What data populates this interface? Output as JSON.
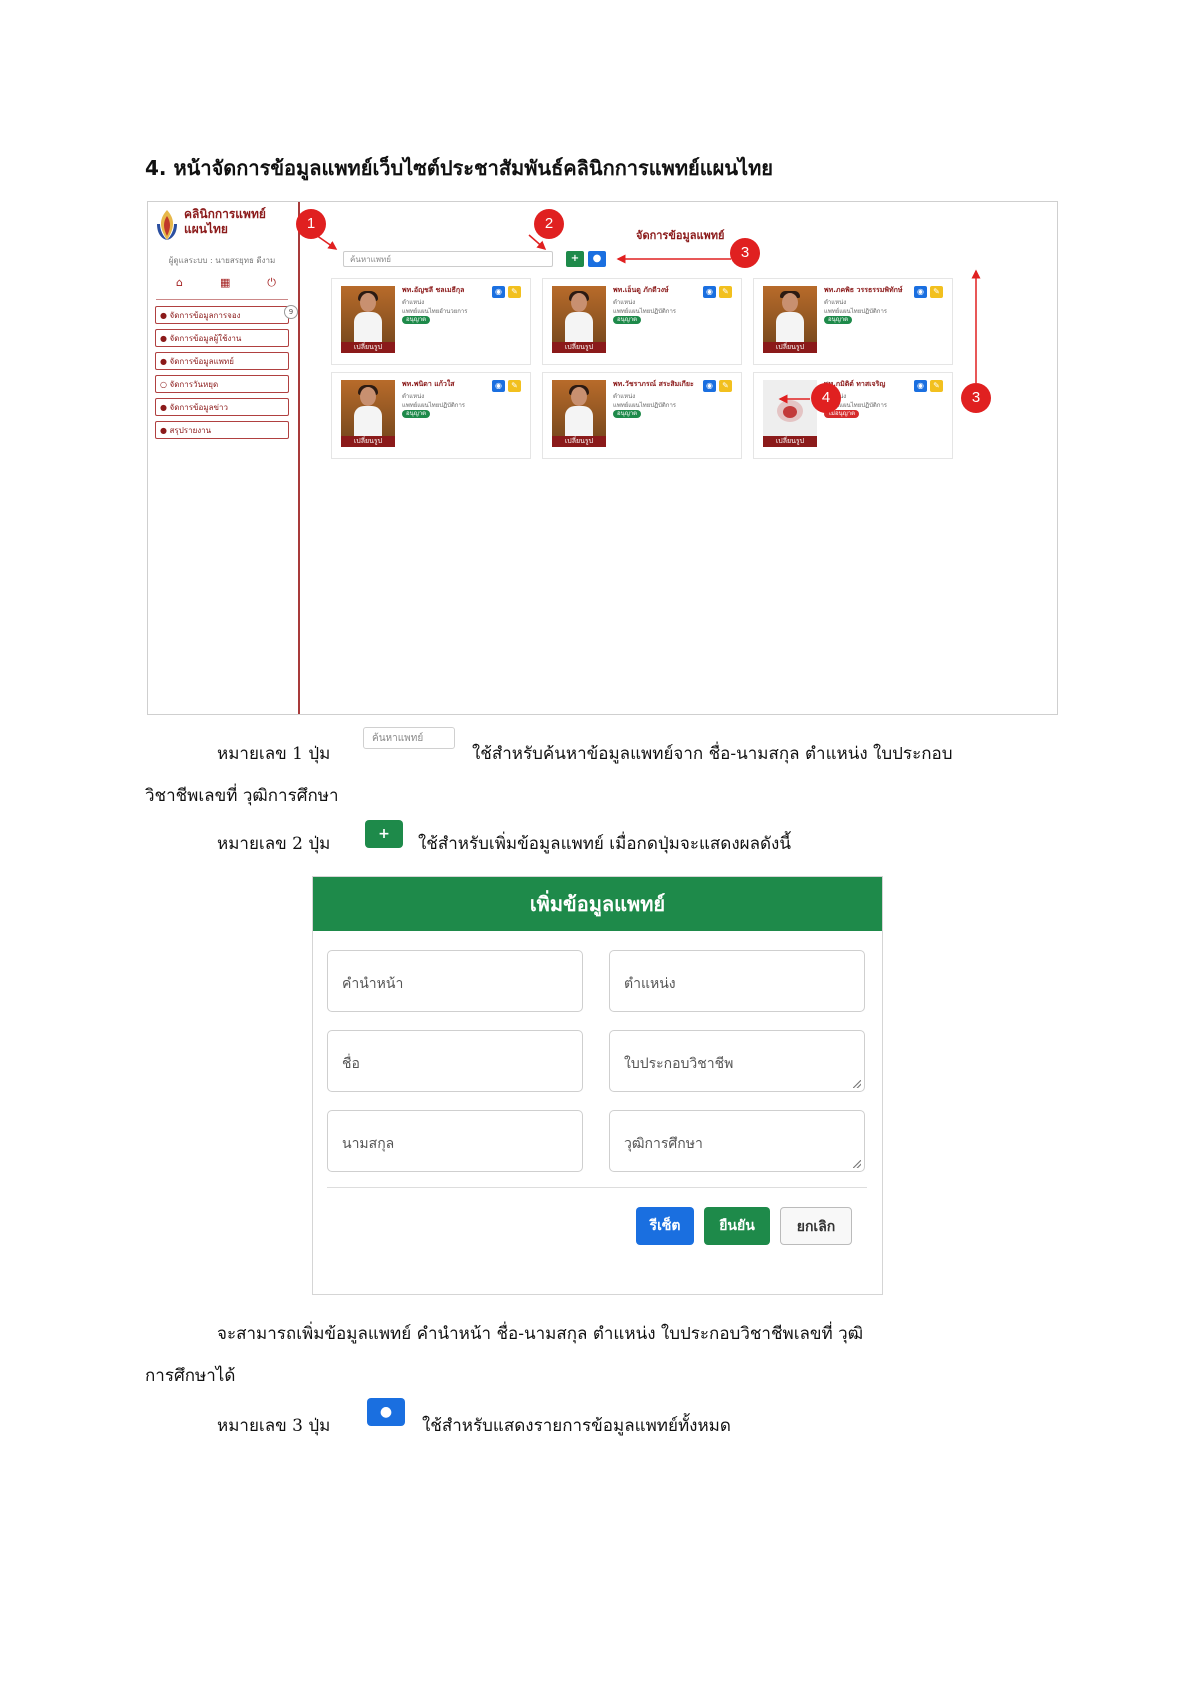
{
  "heading": "4. หน้าจัดการข้อมูลแพทย์เว็บไซต์ประชาสัมพันธ์คลินิกการแพทย์แผนไทย",
  "screenshot": {
    "brand": {
      "line1": "คลินิกการแพทย์",
      "line2": "แผนไทย"
    },
    "user": "ผู้ดูแลระบบ : นายสรยุทธ ดีงาม",
    "sidebar_icons": [
      "home-icon",
      "book-icon",
      "power-icon"
    ],
    "menu_badge": "9",
    "menu": [
      "จัดการข้อมูลการจอง",
      "จัดการข้อมูลผู้ใช้งาน",
      "จัดการข้อมูลแพทย์",
      "จัดการวันหยุด",
      "จัดการข้อมูลข่าว",
      "สรุปรายงาน"
    ],
    "main_title": "จัดการข้อมูลแพทย์",
    "search_placeholder": "ค้นหาแพทย์",
    "add_btn": "+",
    "position_label": "ตำแหน่ง",
    "change_image": "เปลี่ยนรูป",
    "doctors": [
      {
        "name": "พท.อัญชลี ชลเมธีกุล",
        "role": "แพทย์แผนไทยอำนวยการ",
        "status": "อนุญาต",
        "status_color": "#1e8a4a"
      },
      {
        "name": "พท.เอ็นดู ภักดีวงษ์",
        "role": "แพทย์แผนไทยปฏิบัติการ",
        "status": "อนุญาต",
        "status_color": "#1e8a4a"
      },
      {
        "name": "พท.ภคพิธ วรรธรรมพิทักษ์",
        "role": "แพทย์แผนไทยปฏิบัติการ",
        "status": "อนุญาต",
        "status_color": "#1e8a4a"
      },
      {
        "name": "พท.พนิดา แก้วใส",
        "role": "แพทย์แผนไทยปฏิบัติการ",
        "status": "อนุญาต",
        "status_color": "#1e8a4a"
      },
      {
        "name": "พท.วัชราภรณ์ สระสิมเกียะ",
        "role": "แพทย์แผนไทยปฏิบัติการ",
        "status": "อนุญาต",
        "status_color": "#1e8a4a"
      },
      {
        "name": "พท.กมิติต์ ทาสเจริญ",
        "role": "แพทย์แผนไทยปฏิบัติการ",
        "status": "ไม่อนุญาต",
        "status_color": "#d62b2b"
      }
    ],
    "callouts": [
      "1",
      "2",
      "3",
      "3",
      "4"
    ]
  },
  "para1": {
    "lead": "หมายเลข 1 ปุ่ม",
    "button": "ค้นหาแพทย์",
    "text": "ใช้สำหรับค้นหาข้อมูลแพทย์จาก ชื่อ-นามสกุล ตำแหน่ง ใบประกอบ",
    "cont": "วิชาชีพเลขที่ วุฒิการศึกษา"
  },
  "para2": {
    "lead": "หมายเลข 2 ปุ่ม",
    "button": "+",
    "text": "ใช้สำหรับเพิ่มข้อมูลแพทย์ เมื่อกดปุ่มจะแสดงผลดังนี้"
  },
  "modal": {
    "title": "เพิ่มข้อมูลแพทย์",
    "fields": {
      "prefix": "คำนำหน้า",
      "position": "ตำแหน่ง",
      "first_name": "ชื่อ",
      "license": "ใบประกอบวิชาชีพ",
      "last_name": "นามสกุล",
      "education": "วุฒิการศึกษา"
    },
    "reset": "รีเซ็ต",
    "confirm": "ยืนยัน",
    "cancel": "ยกเลิก"
  },
  "para3": {
    "text": "จะสามารถเพิ่มข้อมูลแพทย์ คำนำหน้า ชื่อ-นามสกุล  ตำแหน่ง ใบประกอบวิชาชีพเลขที่ วุฒิ",
    "cont": "การศึกษาได้"
  },
  "para4": {
    "lead": "หมายเลข 3 ปุ่ม",
    "text": "ใช้สำหรับแสดงรายการข้อมูลแพทย์ทั้งหมด"
  },
  "colors": {
    "brand": "#8b1a1a",
    "green": "#1e8a4a",
    "blue": "#1a6fe0",
    "yellow": "#f2c01e",
    "callout": "#e02020"
  }
}
